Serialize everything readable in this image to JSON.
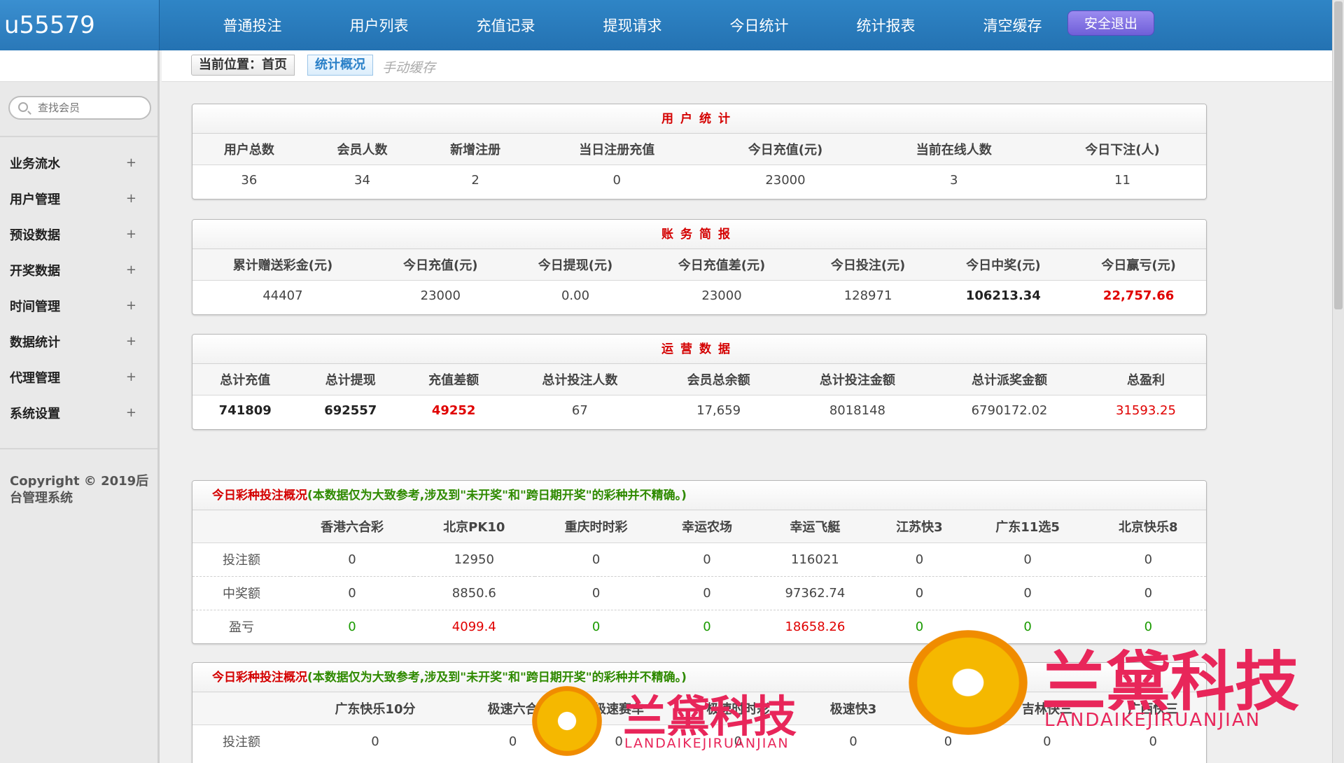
{
  "app": {
    "logo": "u55579"
  },
  "nav": {
    "items": [
      "普通投注",
      "用户列表",
      "充值记录",
      "提现请求",
      "今日统计",
      "统计报表",
      "清空缓存"
    ],
    "logout": "安全退出"
  },
  "sidebar": {
    "search_placeholder": "查找会员",
    "items": [
      "业务流水",
      "用户管理",
      "预设数据",
      "开奖数据",
      "时间管理",
      "数据统计",
      "代理管理",
      "系统设置"
    ],
    "plus": "+",
    "copyright": "Copyright © 2019后台管理系统"
  },
  "breadcrumb": {
    "prefix": "当前位置：首页",
    "current": "统计概况",
    "cache": "手动缓存"
  },
  "user_stats": {
    "title": "用户统计",
    "headers": [
      "用户总数",
      "会员人数",
      "新增注册",
      "当日注册充值",
      "今日充值(元)",
      "当前在线人数",
      "今日下注(人)"
    ],
    "values": [
      "36",
      "34",
      "2",
      "0",
      "23000",
      "3",
      "11"
    ]
  },
  "account_brief": {
    "title": "账务简报",
    "headers": [
      "累计赠送彩金(元)",
      "今日充值(元)",
      "今日提现(元)",
      "今日充值差(元)",
      "今日投注(元)",
      "今日中奖(元)",
      "今日赢亏(元)"
    ],
    "values": [
      "44407",
      "23000",
      "0.00",
      "23000",
      "128971",
      "106213.34",
      "22,757.66"
    ]
  },
  "operations": {
    "title": "运营数据",
    "headers": [
      "总计充值",
      "总计提现",
      "充值差额",
      "总计投注人数",
      "会员总余额",
      "总计投注金额",
      "总计派奖金额",
      "总盈利"
    ],
    "values": [
      "741809",
      "692557",
      "49252",
      "67",
      "17,659",
      "8018148",
      "6790172.02",
      "31593.25"
    ]
  },
  "lottery1": {
    "title_main": "今日彩种投注概况",
    "title_note": "(本数据仅为大致参考,涉及到\"未开奖\"和\"跨日期开奖\"的彩种并不精确。)",
    "headers": [
      "",
      "香港六合彩",
      "北京PK10",
      "重庆时时彩",
      "幸运农场",
      "幸运飞艇",
      "江苏快3",
      "广东11选5",
      "北京快乐8"
    ],
    "rows": [
      {
        "label": "投注额",
        "values": [
          "0",
          "12950",
          "0",
          "0",
          "116021",
          "0",
          "0",
          "0"
        ]
      },
      {
        "label": "中奖额",
        "values": [
          "0",
          "8850.6",
          "0",
          "0",
          "97362.74",
          "0",
          "0",
          "0"
        ]
      },
      {
        "label": "盈亏",
        "values": [
          "0",
          "4099.4",
          "0",
          "0",
          "18658.26",
          "0",
          "0",
          "0"
        ]
      }
    ]
  },
  "lottery2": {
    "title_main": "今日彩种投注概况",
    "title_note": "(本数据仅为大致参考,涉及到\"未开奖\"和\"跨日期开奖\"的彩种并不精确。)",
    "headers": [
      "",
      "广东快乐10分",
      "极速六合",
      "极速赛车",
      "极速时时彩",
      "极速快3",
      "PC蛋蛋",
      "吉林快三",
      "广西快三"
    ],
    "rows": [
      {
        "label": "投注额",
        "values": [
          "0",
          "0",
          "0",
          "0",
          "0",
          "0",
          "0",
          "0"
        ]
      }
    ]
  },
  "watermark": {
    "cn": "兰黛科技",
    "en": "LANDAIKEJIRUANJIAN"
  },
  "colors": {
    "header_blue": "#2a7bbd",
    "alert_red": "#e00000",
    "profit_green": "#1a9a00",
    "logout_purple": "#7a6ae0"
  }
}
